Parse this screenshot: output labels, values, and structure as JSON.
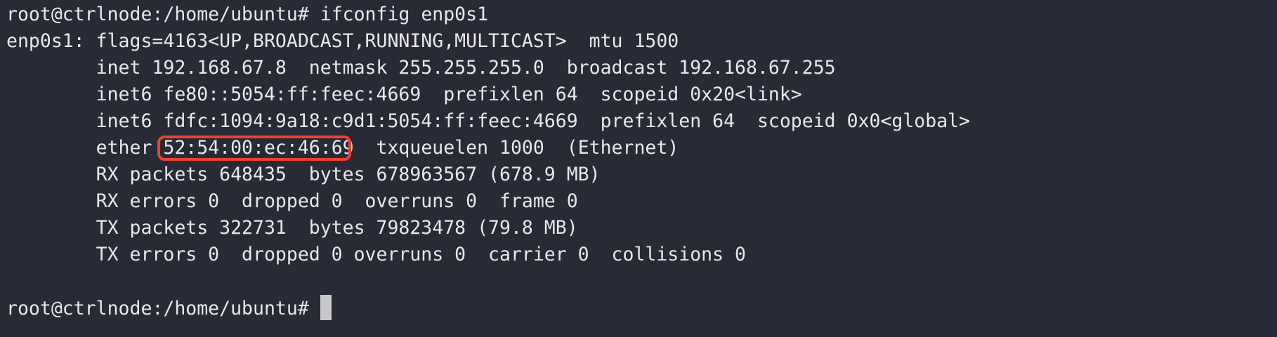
{
  "terminal": {
    "prompt": "root@ctrlnode:/home/ubuntu# ",
    "command": "ifconfig enp0s1",
    "output": [
      "enp0s1: flags=4163<UP,BROADCAST,RUNNING,MULTICAST>  mtu 1500",
      "        inet 192.168.67.8  netmask 255.255.255.0  broadcast 192.168.67.255",
      "        inet6 fe80::5054:ff:feec:4669  prefixlen 64  scopeid 0x20<link>",
      "        inet6 fdfc:1094:9a18:c9d1:5054:ff:feec:4669  prefixlen 64  scopeid 0x0<global>"
    ],
    "ether_prefix": "        ether ",
    "ether_mac": "52:54:00:ec:46:69",
    "ether_suffix": "  txqueuelen 1000  (Ethernet)",
    "output2": [
      "        RX packets 648435  bytes 678963567 (678.9 MB)",
      "        RX errors 0  dropped 0  overruns 0  frame 0",
      "        TX packets 322731  bytes 79823478 (79.8 MB)",
      "        TX errors 0  dropped 0 overruns 0  carrier 0  collisions 0",
      ""
    ],
    "final_prompt": "root@ctrlnode:/home/ubuntu# ",
    "highlight_color": "#e8432e"
  }
}
